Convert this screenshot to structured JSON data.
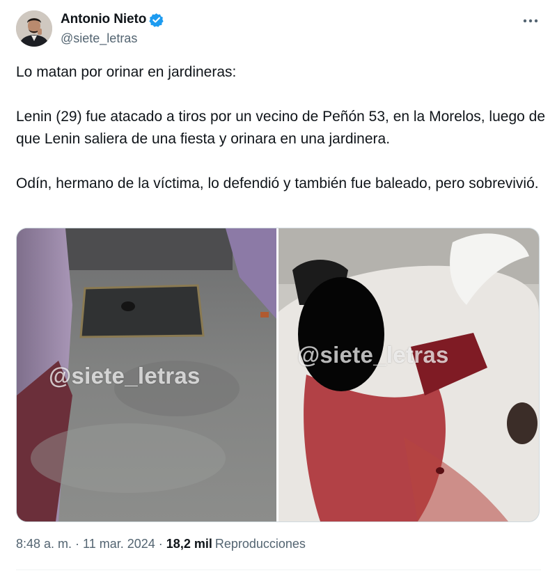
{
  "author": {
    "display_name": "Antonio Nieto",
    "handle": "@siete_letras",
    "verified": true,
    "verified_color": "#1d9bf0"
  },
  "icons": {
    "verified": "verified-badge-icon",
    "more": "more-horizontal-icon"
  },
  "tweet": {
    "paragraphs": [
      "Lo matan por orinar en jardineras:",
      "Lenin (29) fue atacado a tiros por un vecino de Peñón 53, en la Morelos, luego de que Lenin saliera de una fiesta y orinara en una jardinera.",
      "Odín, hermano de la víctima, lo defendió y también fue baleado, pero sobrevivió."
    ]
  },
  "media": {
    "watermark_left": "@siete_letras",
    "watermark_right": "@siete_letras"
  },
  "meta": {
    "time": "8:48 a. m.",
    "separator": "·",
    "date": "11 mar. 2024",
    "views_count": "18,2 mil",
    "views_label": "Reproducciones"
  },
  "colors": {
    "text": "#0f1419",
    "secondary": "#536471",
    "border": "#cfd9de"
  }
}
